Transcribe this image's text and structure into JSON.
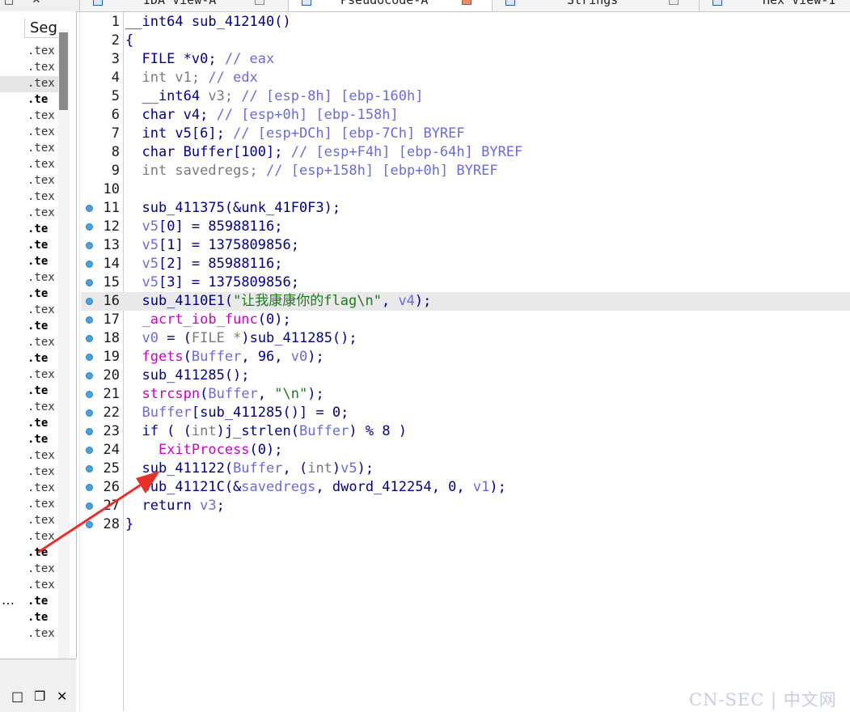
{
  "tabs": [
    {
      "label": "IDA View-A",
      "active": false
    },
    {
      "label": "Pseudocode-A",
      "active": true
    },
    {
      "label": "Strings",
      "active": false
    },
    {
      "label": "Hex View-1",
      "active": false
    }
  ],
  "segments_panel": {
    "header": "Seg",
    "rows": [
      {
        "text": ".tex",
        "bold": false,
        "highlight": false
      },
      {
        "text": ".tex",
        "bold": false,
        "highlight": false
      },
      {
        "text": ".tex",
        "bold": false,
        "highlight": true
      },
      {
        "text": ".te",
        "bold": true,
        "highlight": false
      },
      {
        "text": ".tex",
        "bold": false,
        "highlight": false
      },
      {
        "text": ".tex",
        "bold": false,
        "highlight": false
      },
      {
        "text": ".tex",
        "bold": false,
        "highlight": false
      },
      {
        "text": ".tex",
        "bold": false,
        "highlight": false
      },
      {
        "text": ".tex",
        "bold": false,
        "highlight": false
      },
      {
        "text": ".tex",
        "bold": false,
        "highlight": false
      },
      {
        "text": ".tex",
        "bold": false,
        "highlight": false
      },
      {
        "text": ".te",
        "bold": true,
        "highlight": false
      },
      {
        "text": ".te",
        "bold": true,
        "highlight": false
      },
      {
        "text": ".te",
        "bold": true,
        "highlight": false
      },
      {
        "text": ".tex",
        "bold": false,
        "highlight": false
      },
      {
        "text": ".te",
        "bold": true,
        "highlight": false
      },
      {
        "text": ".tex",
        "bold": false,
        "highlight": false
      },
      {
        "text": ".te",
        "bold": true,
        "highlight": false
      },
      {
        "text": ".tex",
        "bold": false,
        "highlight": false
      },
      {
        "text": ".te",
        "bold": true,
        "highlight": false
      },
      {
        "text": ".tex",
        "bold": false,
        "highlight": false
      },
      {
        "text": ".te",
        "bold": true,
        "highlight": false
      },
      {
        "text": ".tex",
        "bold": false,
        "highlight": false
      },
      {
        "text": ".te",
        "bold": true,
        "highlight": false
      },
      {
        "text": ".te",
        "bold": true,
        "highlight": false
      },
      {
        "text": ".tex",
        "bold": false,
        "highlight": false
      },
      {
        "text": ".tex",
        "bold": false,
        "highlight": false
      },
      {
        "text": ".tex",
        "bold": false,
        "highlight": false
      },
      {
        "text": ".tex",
        "bold": false,
        "highlight": false
      },
      {
        "text": ".tex",
        "bold": false,
        "highlight": false
      },
      {
        "text": ".tex",
        "bold": false,
        "highlight": false
      },
      {
        "text": ".te",
        "bold": true,
        "highlight": false
      },
      {
        "text": ".tex",
        "bold": false,
        "highlight": false
      },
      {
        "text": ".tex",
        "bold": false,
        "highlight": false
      },
      {
        "text": ".te",
        "bold": true,
        "highlight": false
      },
      {
        "text": ".te",
        "bold": true,
        "highlight": false
      },
      {
        "text": ".tex",
        "bold": false,
        "highlight": false
      }
    ],
    "ellipsis": "…"
  },
  "code": {
    "current_line": 16,
    "lines": [
      {
        "n": "1",
        "bp": false,
        "html": "__int64 sub_412140()"
      },
      {
        "n": "2",
        "bp": false,
        "html": "{"
      },
      {
        "n": "3",
        "bp": false,
        "html": "  FILE *v0; <span class=\"cm\">// eax</span>"
      },
      {
        "n": "4",
        "bp": false,
        "html": "  <span class=\"ty\">int v1; </span><span class=\"cm\">// edx</span>"
      },
      {
        "n": "5",
        "bp": false,
        "html": "  __int64 <span class=\"ty\">v3; </span><span class=\"cm\">// [esp-8h] [ebp-160h]</span>"
      },
      {
        "n": "6",
        "bp": false,
        "html": "  char v4; <span class=\"cm\">// [esp+0h] [ebp-158h]</span>"
      },
      {
        "n": "7",
        "bp": false,
        "html": "  int v5[6]; <span class=\"cm\">// [esp+DCh] [ebp-7Ch] BYREF</span>"
      },
      {
        "n": "8",
        "bp": false,
        "html": "  char Buffer[100]; <span class=\"cm\">// [esp+F4h] [ebp-64h] BYREF</span>"
      },
      {
        "n": "9",
        "bp": false,
        "html": "  <span class=\"ty\">int savedregs; </span><span class=\"cm\">// [esp+158h] [ebp+0h] BYREF</span>"
      },
      {
        "n": "10",
        "bp": false,
        "html": ""
      },
      {
        "n": "11",
        "bp": true,
        "html": "  sub_411375(&amp;unk_41F0F3);"
      },
      {
        "n": "12",
        "bp": true,
        "html": "  <span class=\"var\">v5</span>[0] = 85988116;"
      },
      {
        "n": "13",
        "bp": true,
        "html": "  <span class=\"var\">v5</span>[1] = 1375809856;"
      },
      {
        "n": "14",
        "bp": true,
        "html": "  <span class=\"var\">v5</span>[2] = 85988116;"
      },
      {
        "n": "15",
        "bp": true,
        "html": "  <span class=\"var\">v5</span>[3] = 1375809856;"
      },
      {
        "n": "16",
        "bp": true,
        "html": "  sub_4110E1(<span class=\"str\">\"让我康康你的flag\\n\"</span>, <span class=\"var\">v4</span>);"
      },
      {
        "n": "17",
        "bp": true,
        "html": "  <span class=\"api\">_acrt_iob_func</span>(0);"
      },
      {
        "n": "18",
        "bp": true,
        "html": "  <span class=\"var\">v0</span> = (<span class=\"ty\">FILE *</span>)sub_411285();"
      },
      {
        "n": "19",
        "bp": true,
        "html": "  <span class=\"api\">fgets</span>(<span class=\"var\">Buffer</span>, 96, <span class=\"var\">v0</span>);"
      },
      {
        "n": "20",
        "bp": true,
        "html": "  sub_411285();"
      },
      {
        "n": "21",
        "bp": true,
        "html": "  <span class=\"api\">strcspn</span>(<span class=\"var\">Buffer</span>, <span class=\"str\">\"\\n\"</span>);"
      },
      {
        "n": "22",
        "bp": true,
        "html": "  <span class=\"var\">Buffer</span>[sub_411285()] = 0;"
      },
      {
        "n": "23",
        "bp": true,
        "html": "  if ( (<span class=\"ty\">int</span>)j_strlen(<span class=\"var\">Buffer</span>) % 8 )"
      },
      {
        "n": "24",
        "bp": true,
        "html": "    <span class=\"api\">ExitProcess</span>(0);"
      },
      {
        "n": "25",
        "bp": true,
        "html": "  sub_411122(<span class=\"var\">Buffer</span>, (<span class=\"ty\">int</span>)<span class=\"var\">v5</span>);"
      },
      {
        "n": "26",
        "bp": true,
        "html": "  sub_41121C(&amp;<span class=\"var\">savedregs</span>, dword_412254, 0, <span class=\"var\">v1</span>);"
      },
      {
        "n": "27",
        "bp": true,
        "html": "  return <span class=\"var\">v3</span>;"
      },
      {
        "n": "28",
        "bp": true,
        "html": "}"
      }
    ]
  },
  "watermark": "CN-SEC | 中文网",
  "colors": {
    "annotation_arrow": "#e8302a",
    "breakpoint": "#4aa3df",
    "current_line": "#e9e9e9"
  }
}
